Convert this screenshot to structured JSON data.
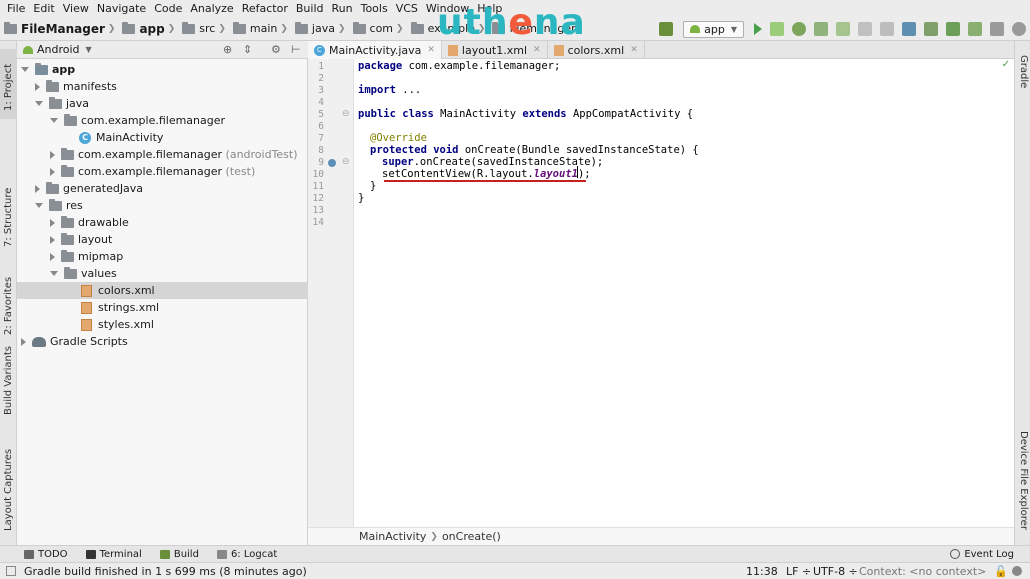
{
  "menu": [
    "File",
    "Edit",
    "View",
    "Navigate",
    "Code",
    "Analyze",
    "Refactor",
    "Build",
    "Run",
    "Tools",
    "VCS",
    "Window",
    "Help"
  ],
  "breadcrumb": [
    "FileManager",
    "app",
    "src",
    "main",
    "java",
    "com",
    "example",
    "filemanager"
  ],
  "watermark": {
    "part1": "uth",
    "part2": "e",
    "part3": "na"
  },
  "run_config": "app",
  "side_tabs": {
    "project": "1: Project",
    "structure": "7: Structure",
    "favorites": "2: Favorites",
    "build_variants": "Build Variants",
    "layout_captures": "Layout Captures",
    "gradle": "Gradle",
    "device_explorer": "Device File Explorer"
  },
  "project_view": "Android",
  "tree": [
    {
      "label": "app",
      "bold": true
    },
    {
      "label": "manifests"
    },
    {
      "label": "java"
    },
    {
      "label": "com.example.filemanager"
    },
    {
      "label": "MainActivity"
    },
    {
      "label": "com.example.filemanager",
      "suffix": "(androidTest)"
    },
    {
      "label": "com.example.filemanager",
      "suffix": "(test)"
    },
    {
      "label": "generatedJava"
    },
    {
      "label": "res"
    },
    {
      "label": "drawable"
    },
    {
      "label": "layout"
    },
    {
      "label": "mipmap"
    },
    {
      "label": "values"
    },
    {
      "label": "colors.xml"
    },
    {
      "label": "strings.xml"
    },
    {
      "label": "styles.xml"
    },
    {
      "label": "Gradle Scripts"
    }
  ],
  "tabs": [
    "MainActivity.java",
    "layout1.xml",
    "colors.xml"
  ],
  "code": {
    "l1a": "package",
    "l1b": " com.example.filemanager;",
    "l3a": "import",
    "l3b": " ...",
    "l5a": "public class",
    "l5b": " MainActivity ",
    "l5c": "extends",
    "l5d": " AppCompatActivity {",
    "l8": "@Override",
    "l9a": "protected void",
    "l9b": " onCreate(Bundle savedInstanceState) {",
    "l10a": "super",
    ".l10b": "",
    "l10b": ".onCreate(savedInstanceState);",
    "l11a": "setContentView(R.layout.",
    "l11b": "layout1",
    "l11c": ");",
    "l12": "}",
    "l13": "}"
  },
  "editor_breadcrumb": {
    "a": "MainActivity",
    "b": "onCreate()"
  },
  "bottom_tabs": [
    "TODO",
    "Terminal",
    "Build",
    "6: Logcat",
    "Event Log"
  ],
  "status": {
    "message": "Gradle build finished in 1 s 699 ms (8 minutes ago)",
    "position": "11:38",
    "line_sep": "LF ÷",
    "encoding": "UTF-8 ÷",
    "context": "Context: <no context>"
  }
}
